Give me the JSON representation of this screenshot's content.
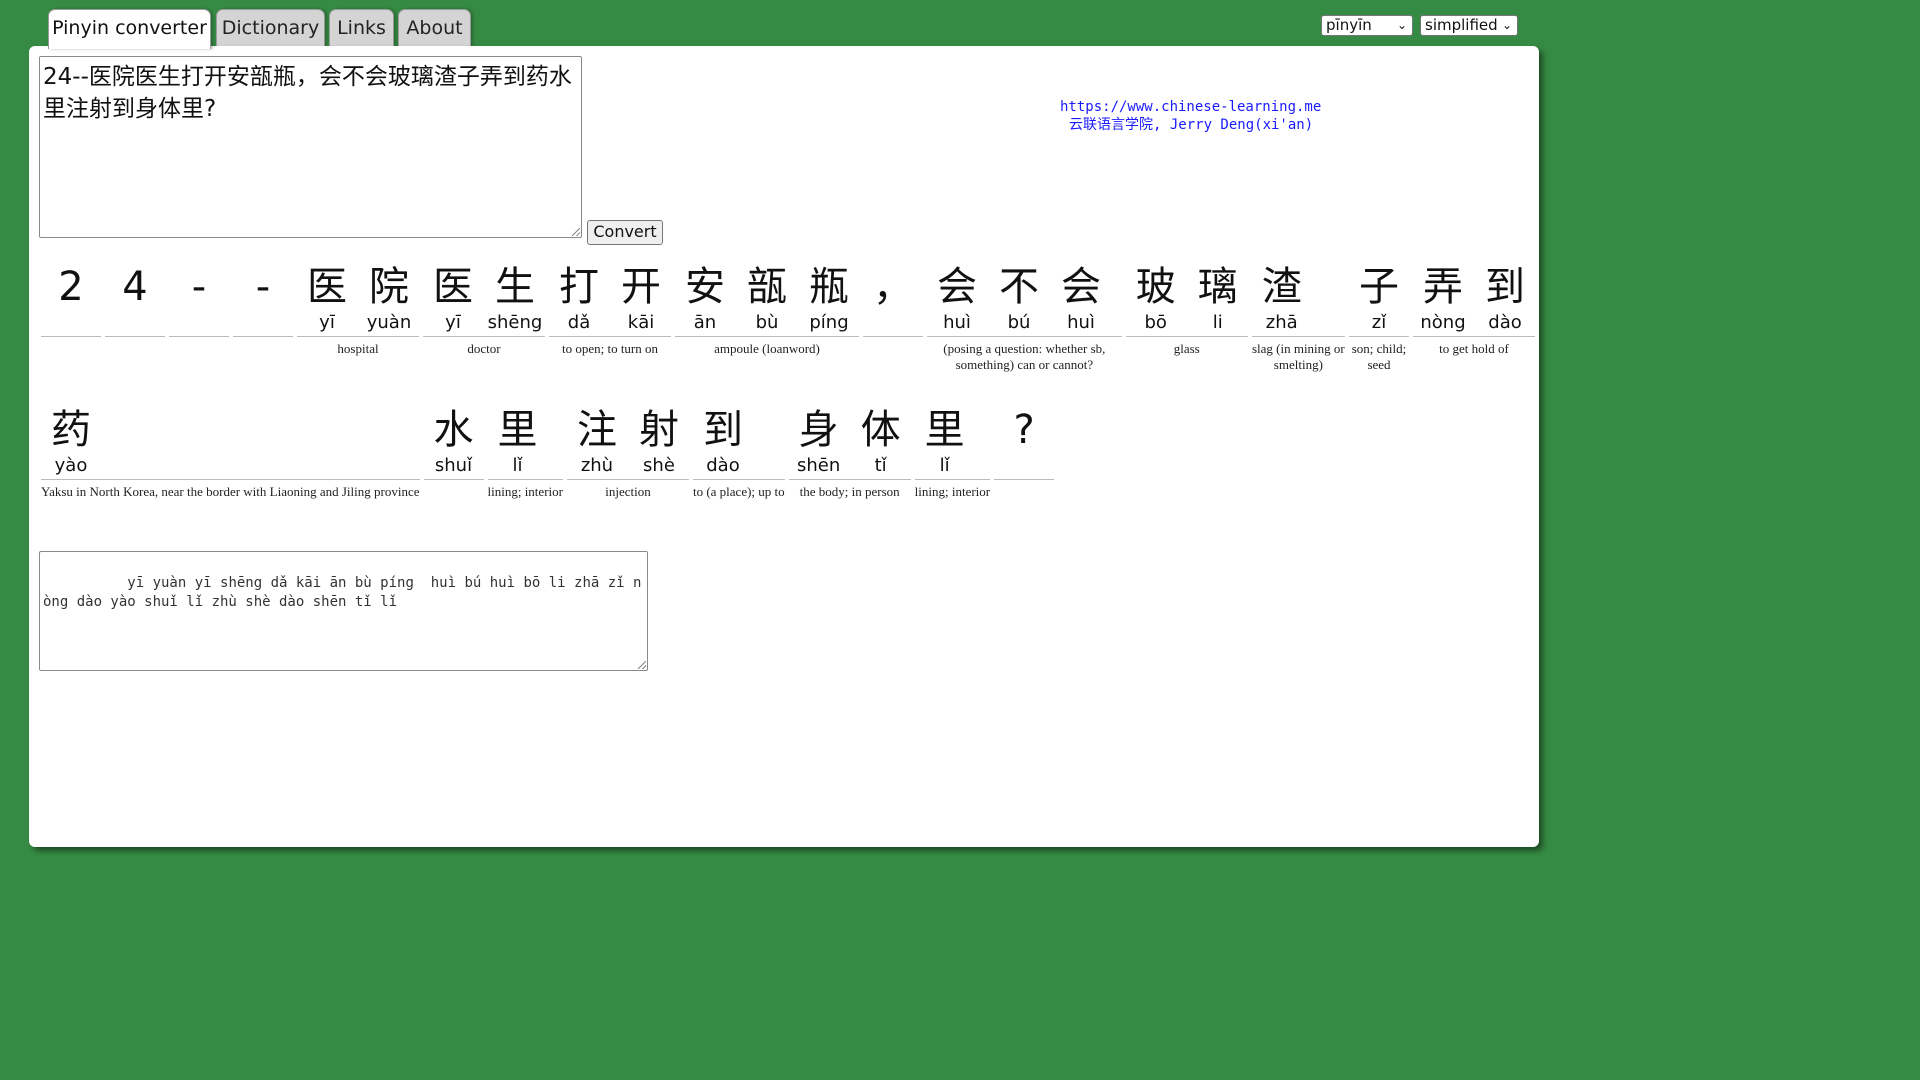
{
  "tabs": [
    {
      "label": "Pinyin converter",
      "active": true
    },
    {
      "label": "Dictionary",
      "active": false
    },
    {
      "label": "Links",
      "active": false
    },
    {
      "label": "About",
      "active": false
    }
  ],
  "selects": {
    "mode": "pīnyīn",
    "script": "simplified"
  },
  "input_text": "24--医院医生打开安瓿瓶，会不会玻璃渣子弄到药水里注射到身体里?",
  "convert_label": "Convert",
  "credit": {
    "url": "https://www.chinese-learning.me",
    "line2": "云联语言学院, Jerry Deng(xi'an)"
  },
  "rows": [
    [
      {
        "chars": [
          {
            "h": "2",
            "p": ""
          }
        ],
        "def": ""
      },
      {
        "chars": [
          {
            "h": "4",
            "p": ""
          }
        ],
        "def": ""
      },
      {
        "chars": [
          {
            "h": "-",
            "p": ""
          }
        ],
        "def": ""
      },
      {
        "chars": [
          {
            "h": "-",
            "p": ""
          }
        ],
        "def": ""
      },
      {
        "chars": [
          {
            "h": "医",
            "p": "yī"
          },
          {
            "h": "院",
            "p": "yuàn"
          }
        ],
        "def": "hospital"
      },
      {
        "chars": [
          {
            "h": "医",
            "p": "yī"
          },
          {
            "h": "生",
            "p": "shēng"
          }
        ],
        "def": "doctor"
      },
      {
        "chars": [
          {
            "h": "打",
            "p": "dǎ"
          },
          {
            "h": "开",
            "p": "kāi"
          }
        ],
        "def": "to open; to turn on"
      },
      {
        "chars": [
          {
            "h": "安",
            "p": "ān"
          },
          {
            "h": "瓿",
            "p": "bù"
          },
          {
            "h": "瓶",
            "p": "píng"
          }
        ],
        "def": "ampoule (loanword)"
      },
      {
        "chars": [
          {
            "h": "，",
            "p": ""
          }
        ],
        "def": ""
      },
      {
        "chars": [
          {
            "h": "会",
            "p": "huì"
          },
          {
            "h": "不",
            "p": "bú"
          },
          {
            "h": "会",
            "p": "huì"
          }
        ],
        "def": "(posing a question: whether sb, something) can or cannot?"
      },
      {
        "chars": [
          {
            "h": "玻",
            "p": "bō"
          },
          {
            "h": "璃",
            "p": "li"
          }
        ],
        "def": "glass"
      },
      {
        "chars": [
          {
            "h": "渣",
            "p": "zhā"
          }
        ],
        "def": "slag (in mining or smelting)"
      },
      {
        "chars": [
          {
            "h": "子",
            "p": "zǐ"
          }
        ],
        "def": "son; child; seed"
      },
      {
        "chars": [
          {
            "h": "弄",
            "p": "nòng"
          },
          {
            "h": "到",
            "p": "dào"
          }
        ],
        "def": "to get hold of"
      }
    ],
    [
      {
        "chars": [
          {
            "h": "药",
            "p": "yào"
          }
        ],
        "def": "Yaksu in North Korea, near the border with Liaoning and Jiling province"
      },
      {
        "chars": [
          {
            "h": "水",
            "p": "shuǐ"
          }
        ],
        "def": ""
      },
      {
        "chars": [
          {
            "h": "里",
            "p": "lǐ"
          }
        ],
        "def": "lining; interior"
      },
      {
        "chars": [
          {
            "h": "注",
            "p": "zhù"
          },
          {
            "h": "射",
            "p": "shè"
          }
        ],
        "def": "injection"
      },
      {
        "chars": [
          {
            "h": "到",
            "p": "dào"
          }
        ],
        "def": "to (a place); up to"
      },
      {
        "chars": [
          {
            "h": "身",
            "p": "shēn"
          },
          {
            "h": "体",
            "p": "tǐ"
          }
        ],
        "def": "the body; in person"
      },
      {
        "chars": [
          {
            "h": "里",
            "p": "lǐ"
          }
        ],
        "def": "lining; interior"
      },
      {
        "chars": [
          {
            "h": "?",
            "p": ""
          }
        ],
        "def": ""
      }
    ]
  ],
  "output_text": "    yī yuàn yī shēng dǎ kāi ān bù píng  huì bú huì bō li zhā zǐ nòng dào yào shuǐ lǐ zhù shè dào shēn tǐ lǐ"
}
